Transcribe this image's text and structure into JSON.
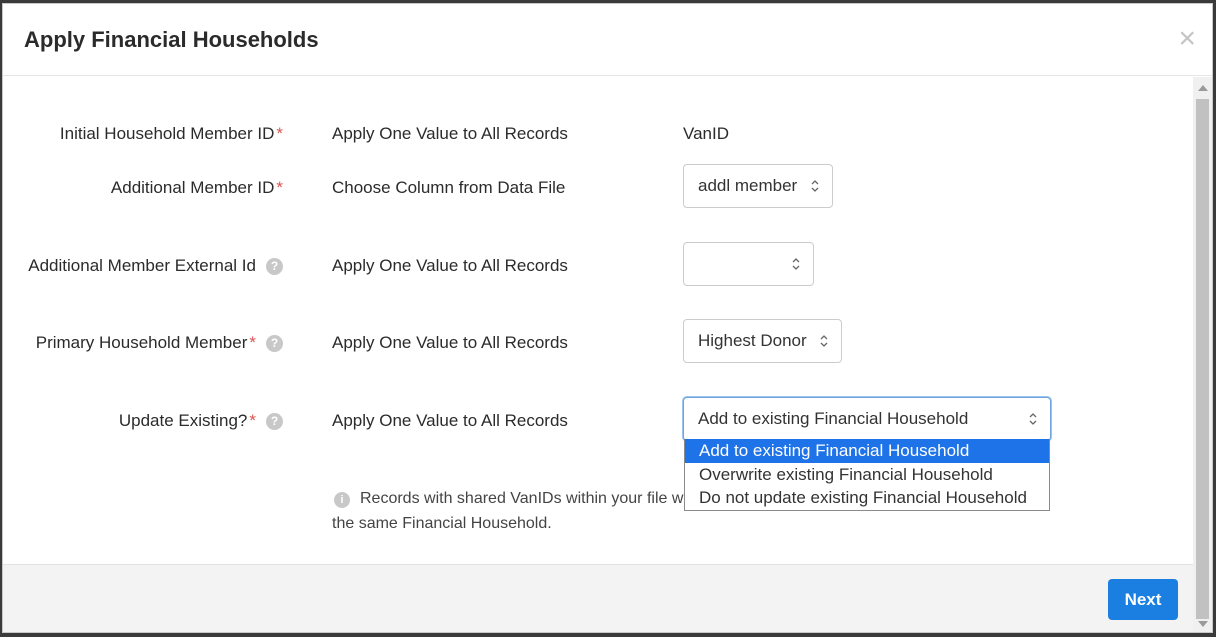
{
  "dialog": {
    "title": "Apply Financial Households",
    "close_glyph": "×"
  },
  "fields": [
    {
      "label": "Initial Household Member ID",
      "required": "*",
      "mode": "Apply One Value to All Records",
      "value": "VanID"
    },
    {
      "label": "Additional Member ID",
      "required": "*",
      "mode": "Choose Column from Data File",
      "value": "addl member"
    },
    {
      "label": "Additional Member External Id",
      "required": "",
      "mode": "Apply One Value to All Records",
      "value": ""
    },
    {
      "label": "Primary Household Member",
      "required": "*",
      "mode": "Apply One Value to All Records",
      "value": "Highest Donor"
    },
    {
      "label": "Update Existing?",
      "required": "*",
      "mode": "Apply One Value to All Records",
      "value": "Add to existing Financial Household"
    }
  ],
  "help_glyph": "?",
  "info_glyph": "i",
  "update_existing_options": [
    {
      "label": "Add to existing Financial Household",
      "selected": true
    },
    {
      "label": "Overwrite existing Financial Household",
      "selected": false
    },
    {
      "label": "Do not update existing Financial Household",
      "selected": false
    }
  ],
  "info_note": {
    "line1": "Records with shared VanIDs within your file w",
    "line2": "the same Financial Household."
  },
  "footer": {
    "next_label": "Next"
  },
  "colors": {
    "accent": "#1a7fe0",
    "required": "#d9534f",
    "selected_option": "#1e73e8"
  }
}
